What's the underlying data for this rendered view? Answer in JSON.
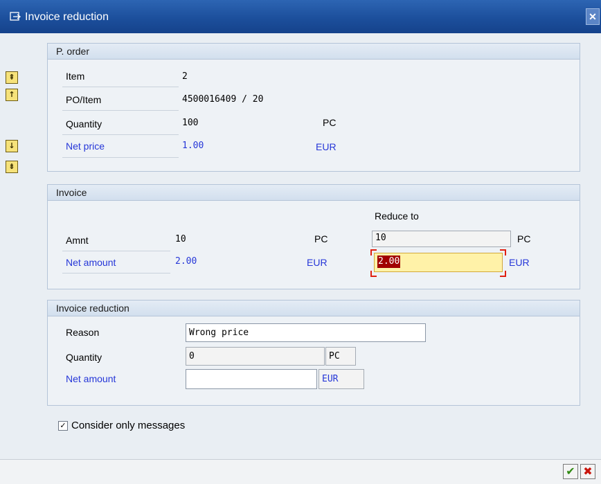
{
  "window": {
    "title": "Invoice reduction",
    "close_glyph": "✕"
  },
  "nav_buttons": [
    "first-page-icon",
    "previous-page-icon",
    "next-page-icon",
    "last-page-icon"
  ],
  "po_order": {
    "header": "P. order",
    "item_label": "Item",
    "item_value": "2",
    "poitem_label": "PO/Item",
    "poitem_value": "4500016409 / 20",
    "quantity_label": "Quantity",
    "quantity_value": "100",
    "quantity_unit": "PC",
    "netprice_label": "Net price",
    "netprice_value": "1.00",
    "netprice_unit": "EUR"
  },
  "invoice": {
    "header": "Invoice",
    "reduce_to_label": "Reduce to",
    "amnt_label": "Amnt",
    "amnt_value": "10",
    "amnt_unit": "PC",
    "amnt_reduce_value": "10",
    "amnt_reduce_unit": "PC",
    "netamount_label": "Net amount",
    "netamount_value": "2.00",
    "netamount_unit": "EUR",
    "netamount_reduce_value": "2.00",
    "netamount_reduce_unit": "EUR"
  },
  "invoice_reduction": {
    "header": "Invoice reduction",
    "reason_label": "Reason",
    "reason_value": "Wrong price",
    "quantity_label": "Quantity",
    "quantity_value": "0",
    "quantity_unit": "PC",
    "netamount_label": "Net amount",
    "netamount_value": "",
    "netamount_unit": "EUR"
  },
  "options": {
    "consider_only_messages_label": "Consider only messages",
    "consider_only_messages_checked": true
  },
  "footer": {
    "ok_glyph": "✔",
    "cancel_glyph": "✖"
  },
  "colors": {
    "title_bar": "#15428b",
    "blue_label": "#2536d8",
    "selection": "#a10000",
    "highlight_field": "#fff2a8"
  }
}
